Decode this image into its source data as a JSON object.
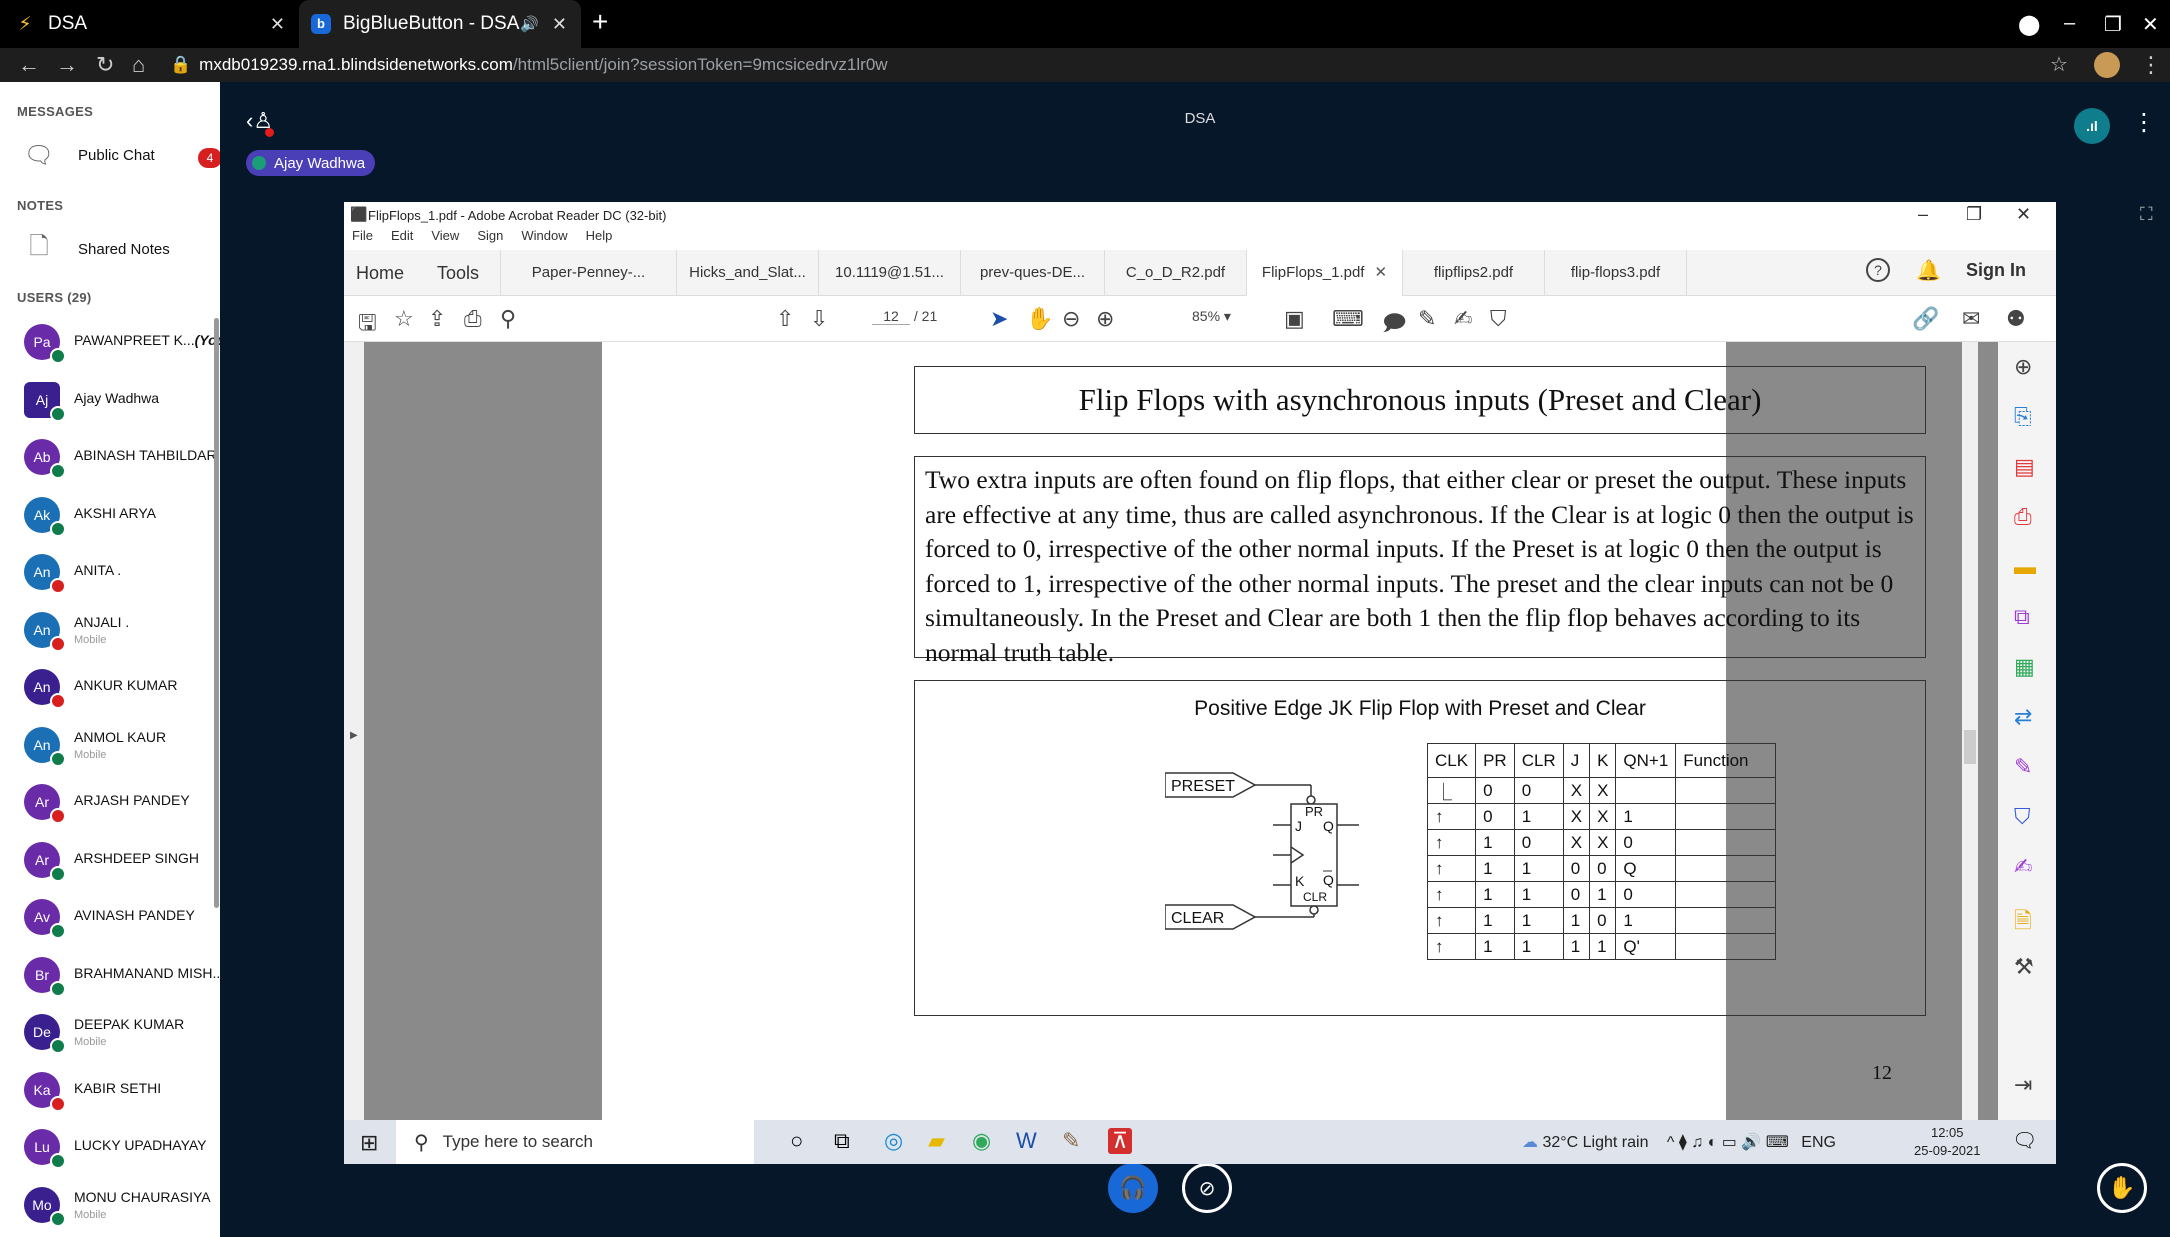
{
  "browser": {
    "tabs": [
      {
        "title": "DSA",
        "icon": "bolt-icon"
      },
      {
        "title": "BigBlueButton - DSA",
        "icon": "bbb-icon"
      }
    ],
    "url_host": "mxdb019239.rna1.blindsidenetworks.com",
    "url_path": "/html5client/join?sessionToken=9mcsicedrvz1lr0w"
  },
  "sidebar": {
    "messages_header": "MESSAGES",
    "public_chat": "Public Chat",
    "public_chat_unread": "4",
    "notes_header": "NOTES",
    "shared_notes": "Shared Notes",
    "users_header": "USERS (29)",
    "users": [
      {
        "initials": "Pa",
        "name": "PAWANPREET K...",
        "you": "(You)",
        "sub": "",
        "color": "#6a2ba8",
        "audio": "on"
      },
      {
        "initials": "Aj",
        "name": "Ajay Wadhwa",
        "you": "",
        "sub": "",
        "color": "#3a1f8f",
        "audio": "on",
        "moderator": true
      },
      {
        "initials": "Ab",
        "name": "ABINASH TAHBILDAR",
        "you": "",
        "sub": "",
        "color": "#6a2ba8",
        "audio": "on"
      },
      {
        "initials": "Ak",
        "name": "AKSHI ARYA",
        "you": "",
        "sub": "",
        "color": "#1b6fb5",
        "audio": "on"
      },
      {
        "initials": "An",
        "name": "ANITA .",
        "you": "",
        "sub": "",
        "color": "#1b6fb5",
        "audio": "off"
      },
      {
        "initials": "An",
        "name": "ANJALI .",
        "you": "",
        "sub": "Mobile",
        "color": "#1b6fb5",
        "audio": "off"
      },
      {
        "initials": "An",
        "name": "ANKUR KUMAR",
        "you": "",
        "sub": "",
        "color": "#3a1f8f",
        "audio": "off"
      },
      {
        "initials": "An",
        "name": "ANMOL KAUR",
        "you": "",
        "sub": "Mobile",
        "color": "#1b6fb5",
        "audio": "on"
      },
      {
        "initials": "Ar",
        "name": "ARJASH PANDEY",
        "you": "",
        "sub": "",
        "color": "#6a2ba8",
        "audio": "off"
      },
      {
        "initials": "Ar",
        "name": "ARSHDEEP SINGH",
        "you": "",
        "sub": "",
        "color": "#6a2ba8",
        "audio": "on"
      },
      {
        "initials": "Av",
        "name": "AVINASH PANDEY",
        "you": "",
        "sub": "",
        "color": "#6a2ba8",
        "audio": "on"
      },
      {
        "initials": "Br",
        "name": "BRAHMANAND MISH...",
        "you": "",
        "sub": "",
        "color": "#6a2ba8",
        "audio": "on"
      },
      {
        "initials": "De",
        "name": "DEEPAK KUMAR",
        "you": "",
        "sub": "Mobile",
        "color": "#3a1f8f",
        "audio": "on"
      },
      {
        "initials": "Ka",
        "name": "KABIR SETHI",
        "you": "",
        "sub": "",
        "color": "#6a2ba8",
        "audio": "off"
      },
      {
        "initials": "Lu",
        "name": "LUCKY UPADHAYAY",
        "you": "",
        "sub": "",
        "color": "#6a2ba8",
        "audio": "on"
      },
      {
        "initials": "Mo",
        "name": "MONU CHAURASIYA",
        "you": "",
        "sub": "Mobile",
        "color": "#3a1f8f",
        "audio": "on"
      }
    ]
  },
  "meeting": {
    "title": "DSA",
    "presenter": "Ajay Wadhwa",
    "connection_label": ".ıl"
  },
  "acrobat": {
    "window_title": "FlipFlops_1.pdf - Adobe Acrobat Reader DC (32-bit)",
    "menu": [
      "File",
      "Edit",
      "View",
      "Sign",
      "Window",
      "Help"
    ],
    "home": "Home",
    "tools": "Tools",
    "tabs": [
      "Paper-Penney-...",
      "Hicks_and_Slat...",
      "10.1119@1.51...",
      "prev-ques-DE...",
      "C_o_D_R2.pdf",
      "FlipFlops_1.pdf",
      "flipflips2.pdf",
      "flip-flops3.pdf"
    ],
    "active_tab_index": 5,
    "sign_in": "Sign In",
    "page_current": "12",
    "page_total": "/ 21",
    "zoom": "85%"
  },
  "pdf_page": {
    "title": "Flip Flops with asynchronous inputs (Preset and Clear)",
    "paragraph": "Two extra inputs are often found on flip flops, that either clear or preset the output. These inputs are effective at any time, thus are called asynchronous. If the Clear is at logic 0 then the output is forced to 0, irrespective of the other normal inputs. If the Preset is at logic 0 then the output is forced to 1, irrespective of the other normal inputs. The preset and the clear inputs can not be 0 simultaneously. In the Preset and Clear are both 1 then the flip flop behaves according to its normal truth table.",
    "diagram_title": "Positive Edge JK Flip Flop with Preset and Clear",
    "preset_label": "PRESET",
    "clear_label": "CLEAR",
    "pin_pr": "PR",
    "pin_j": "J",
    "pin_q": "Q",
    "pin_k": "K",
    "pin_clr": "CLR",
    "pin_qbar": "Q",
    "truth_headers": [
      "CLK",
      "PR",
      "CLR",
      "J",
      "K",
      "QN+1",
      "Function"
    ],
    "truth_rows": [
      [
        "⎿",
        "0",
        "0",
        "X",
        "X",
        "",
        ""
      ],
      [
        "↑",
        "0",
        "1",
        "X",
        "X",
        "1",
        ""
      ],
      [
        "↑",
        "1",
        "0",
        "X",
        "X",
        "0",
        ""
      ],
      [
        "↑",
        "1",
        "1",
        "0",
        "0",
        "Q",
        ""
      ],
      [
        "↑",
        "1",
        "1",
        "0",
        "1",
        "0",
        ""
      ],
      [
        "↑",
        "1",
        "1",
        "1",
        "0",
        "1",
        ""
      ],
      [
        "↑",
        "1",
        "1",
        "1",
        "1",
        "Q'",
        ""
      ]
    ],
    "page_number": "12"
  },
  "taskbar": {
    "search_placeholder": "Type here to search",
    "weather": "32°C  Light rain",
    "lang": "ENG",
    "time": "12:05",
    "date": "25-09-2021"
  }
}
